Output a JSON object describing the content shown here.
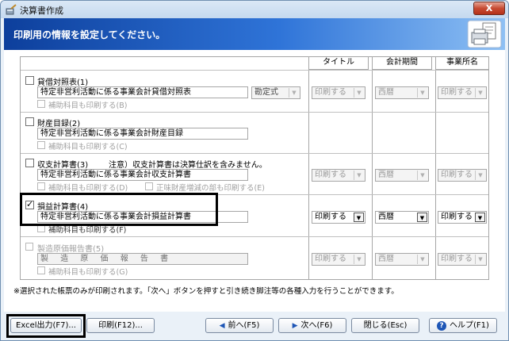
{
  "window": {
    "title": "決算書作成",
    "close_label": "X"
  },
  "header": {
    "title": "印刷用の情報を設定してください。"
  },
  "columns": [
    "タイトル",
    "会計期間",
    "事業所名"
  ],
  "sections": [
    {
      "label": "貸借対照表(1)",
      "field": "特定非営利活動に係る事業会計貸借対照表",
      "extra_select": "勘定式",
      "sub_options": [
        "補助科目も印刷する(B)"
      ],
      "title_select": "印刷する",
      "period_select": "西暦",
      "office_select": "印刷する"
    },
    {
      "label": "財産目録(2)",
      "field": "特定非営利活動に係る事業会計財産目録",
      "sub_options": [
        "補助科目も印刷する(C)"
      ]
    },
    {
      "label": "収支計算書(3)",
      "notice": "注意）収支計算書は決算仕訳を含みません。",
      "field": "特定非営利活動に係る事業会計収支計算書",
      "sub_options": [
        "補助科目も印刷する(D)",
        "正味財産増減の部も印刷する(E)"
      ],
      "title_select": "印刷する",
      "period_select": "西暦",
      "office_select": "印刷する"
    },
    {
      "label": "損益計算書(4)",
      "field": "特定非営利活動に係る事業会計損益計算書",
      "sub_options": [
        "補助科目も印刷する(F)"
      ],
      "title_select": "印刷する",
      "period_select": "西暦",
      "office_select": "印刷する"
    },
    {
      "label": "製造原価報告書(5)",
      "field": "製 造 原 価 報 告 書",
      "sub_options": [
        "補助科目も印刷する(G)"
      ],
      "title_select": "印刷する",
      "period_select": "西暦",
      "office_select": "印刷する"
    }
  ],
  "note": "※選択された帳票のみが印刷されます。「次へ」ボタンを押すと引き続き脚注等の各種入力を行うことができます。",
  "buttons": {
    "excel": "Excel出力(F7)...",
    "print": "印刷(F12)...",
    "prev": "前へ(F5)",
    "next": "次へ(F6)",
    "close": "閉じる(Esc)",
    "help": "ヘルプ(F1)"
  },
  "icons": {
    "prev": "triangle-left",
    "next": "triangle-right",
    "help": "question-mark",
    "app": "calculator-pen",
    "header": "printer-document"
  }
}
